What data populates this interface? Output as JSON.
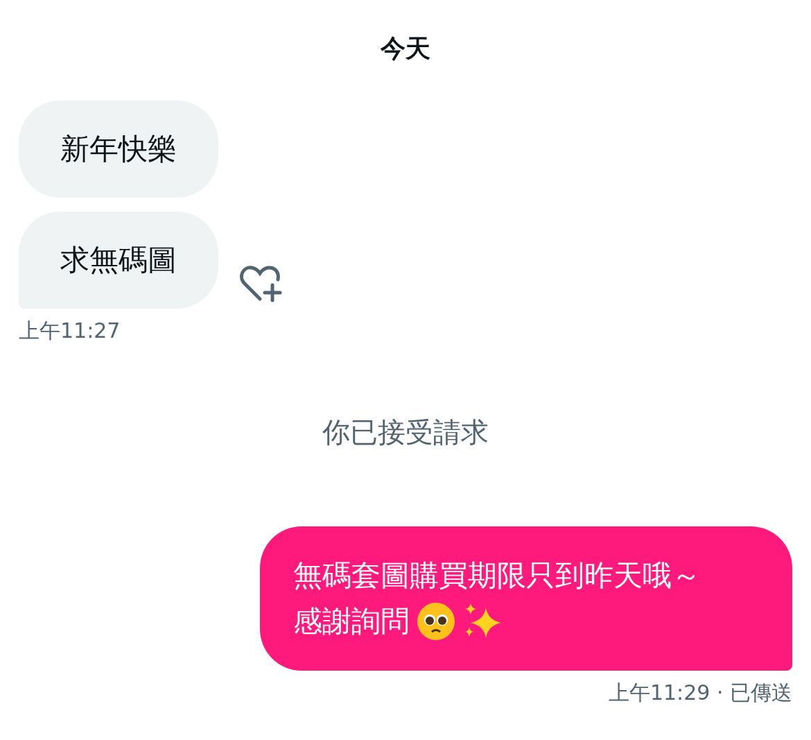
{
  "date_header": "今天",
  "incoming": {
    "messages": [
      {
        "text": "新年快樂",
        "last": false
      },
      {
        "text": "求無碼圖",
        "last": true
      }
    ],
    "time": "上午11:27"
  },
  "system_notice": "你已接受請求",
  "outgoing": {
    "lines": [
      "無碼套圖購買期限只到昨天哦～",
      "感謝詢問"
    ],
    "footer": "上午11:29 · 已傳送"
  }
}
